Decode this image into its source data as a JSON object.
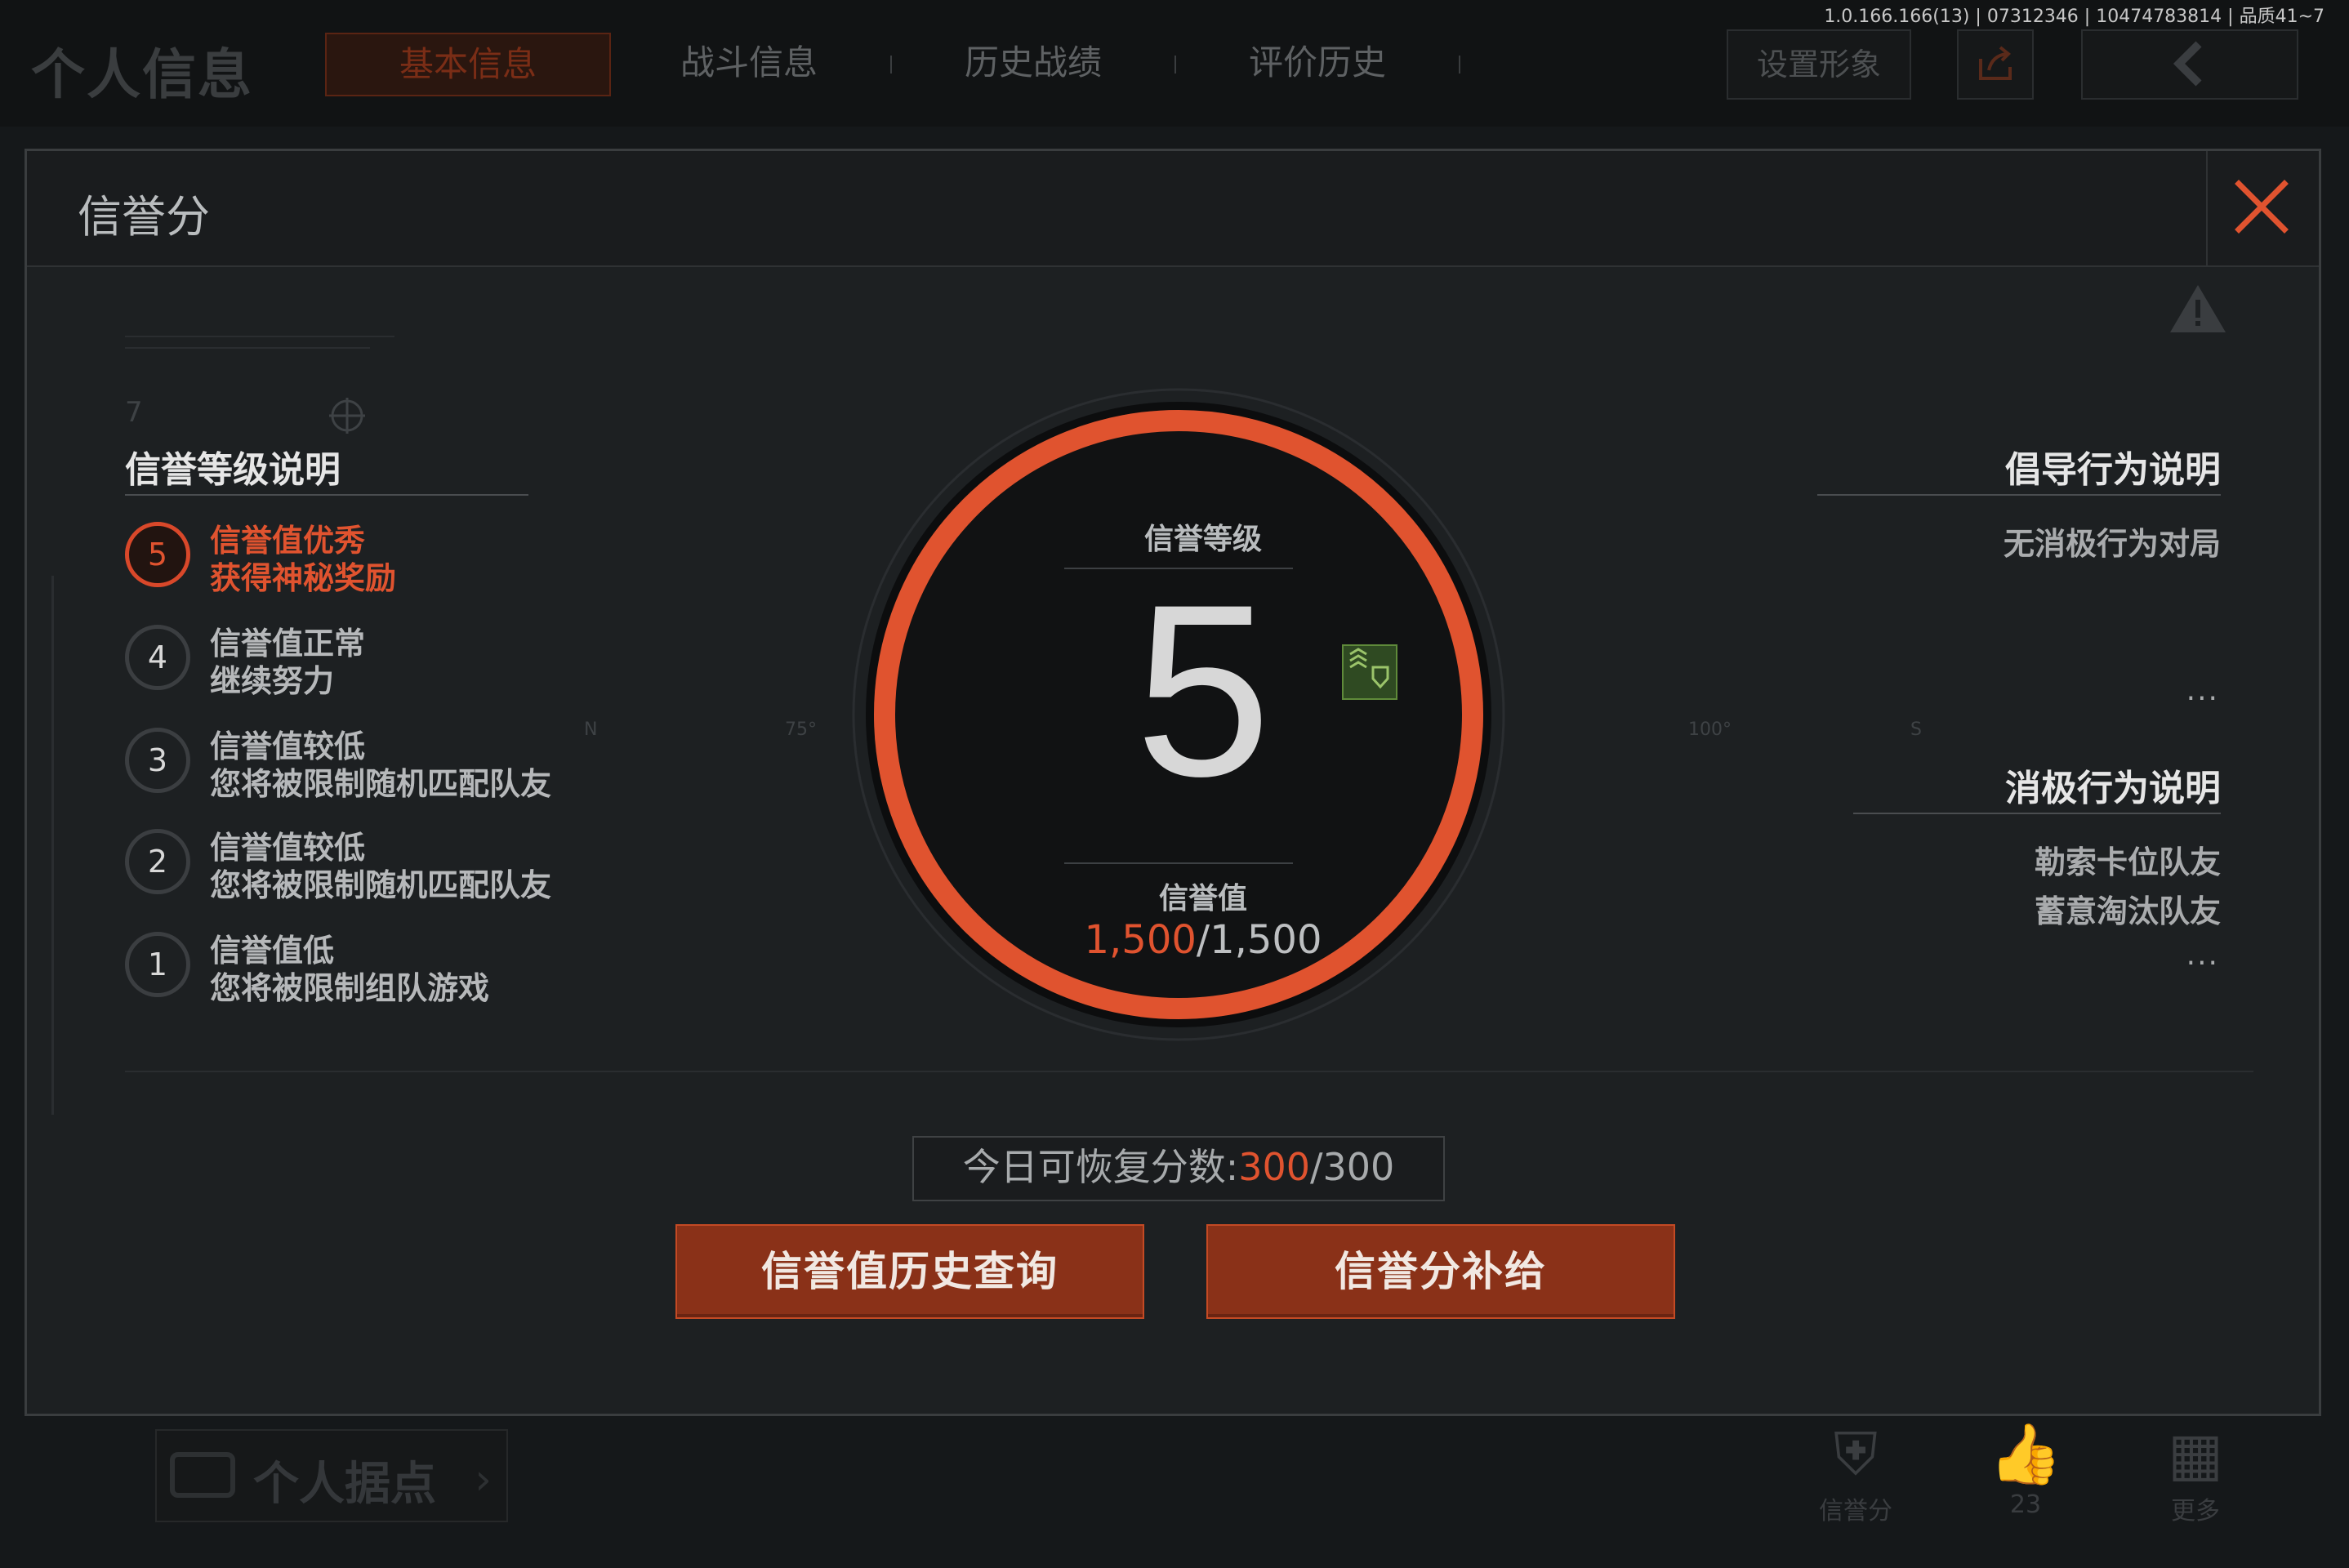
{
  "version_text": "1.0.166.166(13) | 07312346 | 10474783814 | 品质41~7",
  "background_page": {
    "title": "个人信息",
    "tabs": [
      {
        "label": "基本信息",
        "active": true
      },
      {
        "label": "战斗信息",
        "active": false
      },
      {
        "label": "历史战绩",
        "active": false
      },
      {
        "label": "评价历史",
        "active": false
      }
    ],
    "set_appearance_label": "设置形象",
    "personal_base_label": "个人据点",
    "bottom_nav": [
      {
        "icon": "shield-star-icon",
        "label": "信誉分"
      },
      {
        "icon": "thumbs-up-icon",
        "label": "23"
      },
      {
        "icon": "grid-more-icon",
        "label": "更多"
      }
    ]
  },
  "dialog": {
    "title": "信誉分",
    "left_section": {
      "title": "信誉等级说明",
      "levels": [
        {
          "level": "5",
          "line1": "信誉值优秀",
          "line2": "获得神秘奖励",
          "active": true
        },
        {
          "level": "4",
          "line1": "信誉值正常",
          "line2": "继续努力",
          "active": false
        },
        {
          "level": "3",
          "line1": "信誉值较低",
          "line2": "您将被限制随机匹配队友",
          "active": false
        },
        {
          "level": "2",
          "line1": "信誉值较低",
          "line2": "您将被限制随机匹配队友",
          "active": false
        },
        {
          "level": "1",
          "line1": "信誉值低",
          "line2": "您将被限制组队游戏",
          "active": false
        }
      ]
    },
    "right_section": {
      "advocate_title": "倡导行为说明",
      "advocate_items": [
        "无消极行为对局"
      ],
      "advocate_more": "...",
      "negative_title": "消极行为说明",
      "negative_items": [
        "勒索卡位队友",
        "蓄意淘汰队友"
      ],
      "negative_more": "..."
    },
    "center": {
      "level_label": "信誉等级",
      "level": "5",
      "value_label": "信誉值",
      "value_current": "1,500",
      "value_max": "/1,500",
      "progress_fraction": 1.0
    },
    "today": {
      "label": "今日可恢复分数:",
      "current": "300",
      "max": "/300"
    },
    "buttons": {
      "history": "信誉值历史查询",
      "supplement": "信誉分补给"
    },
    "deco": {
      "small_number": "7",
      "compass_n": "N",
      "compass_75": "75°",
      "compass_100": "100°",
      "compass_s": "S"
    }
  },
  "colors": {
    "accent": "#e0532f",
    "button": "#8a3118",
    "panel": "#1d2022"
  }
}
